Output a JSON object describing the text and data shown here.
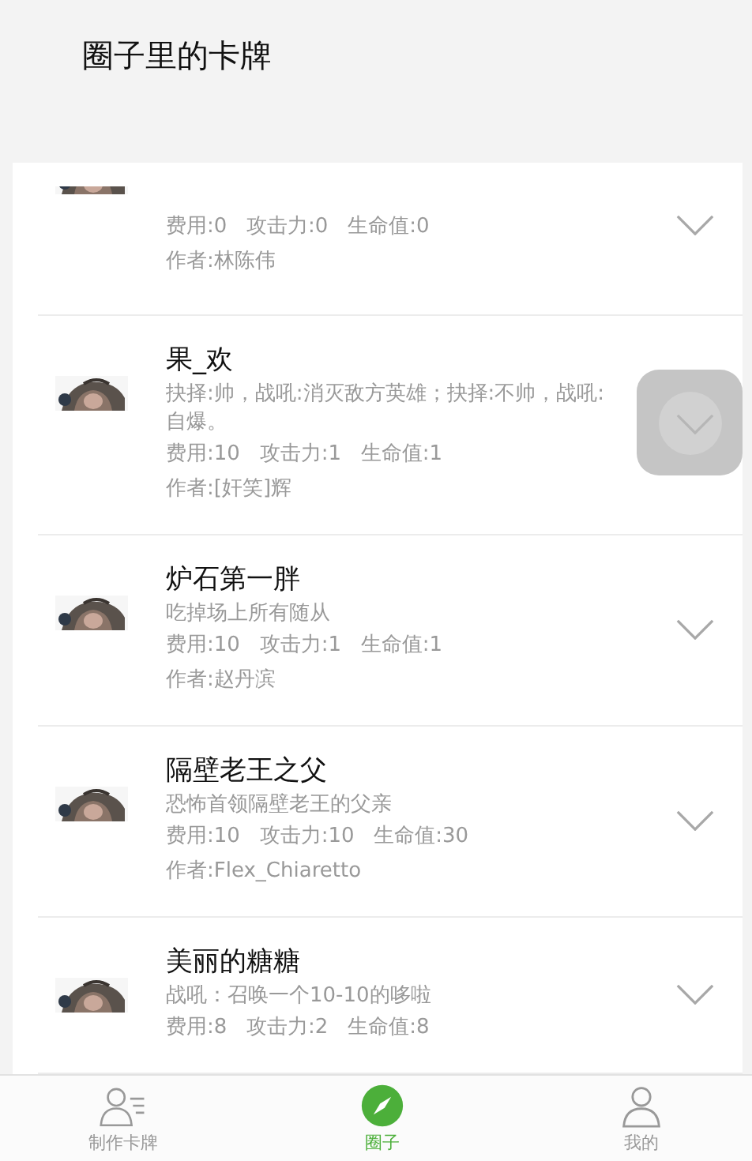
{
  "header": {
    "title": "圈子里的卡牌"
  },
  "cards": [
    {
      "kind": "picture",
      "stats": "费用:0   攻击力:0   生命值:0",
      "author": "作者:林陈伟"
    },
    {
      "kind": "picture",
      "name": "果_欢",
      "description": "抉择:帅，战吼:消灭敌方英雄；抉择:不帅，战吼:自爆。",
      "stats": "费用:10   攻击力:1   生命值:1",
      "author": "作者:[奸笑]辉"
    },
    {
      "kind": "picture",
      "name": "炉石第一胖",
      "description": "吃掉场上所有随从",
      "stats": "费用:10   攻击力:1   生命值:1",
      "author": "作者:赵丹滨"
    },
    {
      "kind": "picture",
      "name": "隔壁老王之父",
      "description": "恐怖首领隔壁老王的父亲",
      "stats": "费用:10   攻击力:10   生命值:30",
      "author": "作者:Flex_Chiaretto"
    },
    {
      "kind": "picture",
      "name": "美丽的糖糖",
      "description": "战吼：召唤一个10-10的哆啦",
      "stats": "费用:8   攻击力:2   生命值:8"
    }
  ],
  "tabs": [
    {
      "label": "制作卡牌",
      "kind": "make",
      "selected": false
    },
    {
      "label": "圈子",
      "kind": "circle",
      "selected": true
    },
    {
      "label": "我的",
      "kind": "me",
      "selected": false
    }
  ]
}
